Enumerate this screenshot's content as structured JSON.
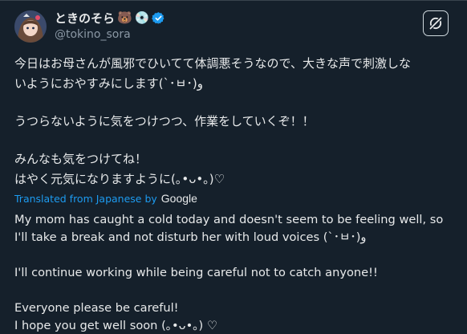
{
  "tweet": {
    "display_name": "ときのそら",
    "name_emojis": [
      "🐻",
      "💿"
    ],
    "verified_icon": "verified-badge-icon",
    "handle": "@tokino_sora",
    "grok_icon": "grok-icon",
    "original_lines": [
      "今日はお母さんが風邪でひいてて体調悪そうなので、大きな声で刺激しな",
      "いようにおやすみにします(`･ㅂ･)و",
      "",
      "うつらないように気をつけつつ、作業をしていくぞ！！",
      "",
      "みんなも気をつけてね！",
      "はやく元気になりますように(｡•ᴗ•｡)♡"
    ],
    "translated_label": "Translated from Japanese by",
    "translator": "Google",
    "translation_lines": [
      "My mom has caught a cold today and doesn't seem to be feeling well, so",
      "I'll take a break and not disturb her with loud voices (`･ㅂ･)و",
      "",
      "I'll continue working while being careful not to catch anyone!!",
      "",
      "Everyone please be careful!",
      "I hope you get well soon (｡•ᴗ•｡) ♡"
    ]
  },
  "colors": {
    "background": "#15202b",
    "text": "#e7e9ea",
    "secondary": "#8b98a5",
    "link": "#1d9bf0",
    "verified": "#1d9bf0"
  }
}
